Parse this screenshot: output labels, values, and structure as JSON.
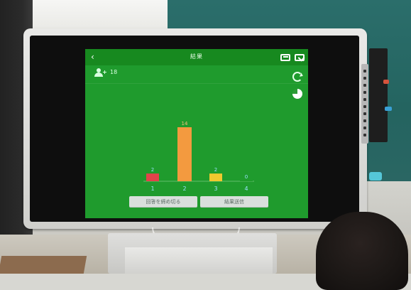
{
  "screen": {
    "title": "結果",
    "participants": "18",
    "buttons": {
      "left": "回答を締め切る",
      "right": "結果送信"
    },
    "icons": {
      "back": "back-icon",
      "display": "display-icon",
      "expand": "expand-icon",
      "refresh": "refresh-icon",
      "pie": "pie-chart-icon",
      "people": "people-icon"
    }
  },
  "chart_data": {
    "type": "bar",
    "categories": [
      "1",
      "2",
      "3",
      "4"
    ],
    "values": [
      2,
      14,
      2,
      0
    ],
    "colors": [
      "#e2434a",
      "#f39a3f",
      "#f1c92f",
      "#1f9b2d"
    ]
  }
}
